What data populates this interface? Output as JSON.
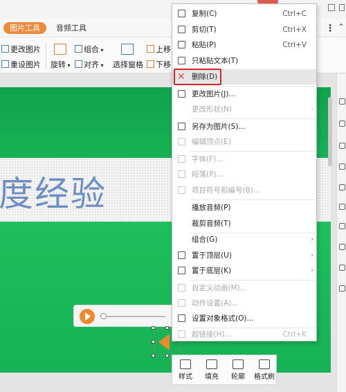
{
  "tabs": {
    "active": "图片工具",
    "other": "音频工具"
  },
  "ribbon": {
    "change_picture": "更改图片",
    "reset_picture": "重设图片",
    "rotate": "旋转",
    "group": "组合",
    "align": "对齐",
    "selection_pane": "选择窗格",
    "move_up": "上移",
    "move_down": "下移"
  },
  "slide": {
    "band_text": "度经验"
  },
  "context_menu": {
    "items": [
      {
        "label": "复制(C)",
        "shortcut": "Ctrl+C",
        "icon": "copy-icon"
      },
      {
        "label": "剪切(T)",
        "shortcut": "Ctrl+X",
        "icon": "scissors-icon"
      },
      {
        "label": "粘贴(P)",
        "shortcut": "Ctrl+V",
        "icon": "paste-icon"
      },
      {
        "label": "只粘贴文本(T)",
        "shortcut": "",
        "icon": "paste-text-icon"
      },
      {
        "label": "删除(D)",
        "shortcut": "",
        "icon": "delete-icon",
        "highlighted": true
      },
      {
        "label": "更改图片(J)...",
        "shortcut": "",
        "icon": "change-picture-icon"
      },
      {
        "label": "更改形状(N)",
        "shortcut": "",
        "icon": "",
        "disabled": true,
        "submenu": true
      },
      {
        "label": "另存为图片(S)...",
        "shortcut": "",
        "icon": "save-picture-icon"
      },
      {
        "label": "编辑顶点(E)",
        "shortcut": "",
        "icon": "edit-points-icon",
        "disabled": true
      },
      {
        "label": "字体(F)...",
        "shortcut": "",
        "icon": "font-icon",
        "disabled": true
      },
      {
        "label": "段落(P)...",
        "shortcut": "",
        "icon": "paragraph-icon",
        "disabled": true
      },
      {
        "label": "项目符号和编号(B)...",
        "shortcut": "",
        "icon": "bullets-icon",
        "disabled": true
      },
      {
        "label": "播放音频(P)",
        "shortcut": "",
        "icon": ""
      },
      {
        "label": "裁剪音频(T)",
        "shortcut": "",
        "icon": ""
      },
      {
        "label": "组合(G)",
        "shortcut": "",
        "icon": "",
        "submenu": true
      },
      {
        "label": "置于顶层(U)",
        "shortcut": "",
        "icon": "bring-front-icon",
        "submenu": true
      },
      {
        "label": "置于底层(K)",
        "shortcut": "",
        "icon": "send-back-icon",
        "submenu": true
      },
      {
        "label": "自定义动画(M)...",
        "shortcut": "",
        "icon": "animation-icon",
        "disabled": true
      },
      {
        "label": "动作设置(A)...",
        "shortcut": "",
        "icon": "action-icon",
        "disabled": true
      },
      {
        "label": "设置对象格式(O)...",
        "shortcut": "",
        "icon": "format-object-icon"
      },
      {
        "label": "超链接(H)...",
        "shortcut": "Ctrl+K",
        "icon": "hyperlink-icon",
        "disabled": true
      }
    ]
  },
  "mini_toolbar": {
    "style": "样式",
    "fill": "填充",
    "outline": "轮廓",
    "format_painter": "格式刷"
  },
  "colors": {
    "accent": "#f08a3b",
    "slide_green": "#16b255",
    "delete_box": "#d0262a"
  }
}
